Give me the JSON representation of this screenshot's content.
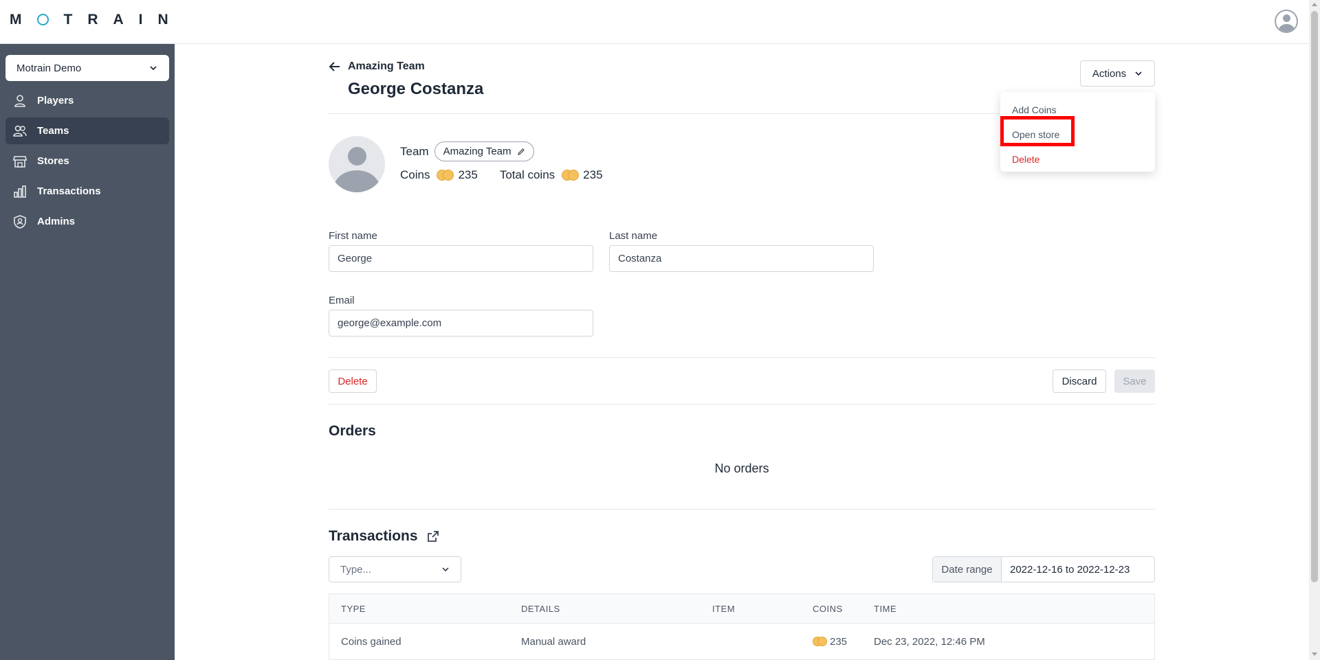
{
  "app": {
    "logo_letters": [
      "M",
      "O",
      "T",
      "R",
      "A",
      "I",
      "N"
    ],
    "accent_color": "#2aa9c9"
  },
  "sidebar": {
    "account": "Motrain Demo",
    "items": [
      {
        "label": "Players",
        "icon": "user-icon"
      },
      {
        "label": "Teams",
        "icon": "users-icon",
        "active": true
      },
      {
        "label": "Stores",
        "icon": "store-icon"
      },
      {
        "label": "Transactions",
        "icon": "chart-bar-icon"
      },
      {
        "label": "Admins",
        "icon": "shield-user-icon"
      }
    ]
  },
  "header": {
    "back_label": "Amazing Team",
    "title": "George Costanza"
  },
  "actions": {
    "button_label": "Actions",
    "menu": [
      {
        "label": "Add Coins"
      },
      {
        "label": "Open store"
      },
      {
        "label": "Delete"
      }
    ]
  },
  "profile": {
    "team_label": "Team",
    "team_name": "Amazing Team",
    "coins_label": "Coins",
    "coins": "235",
    "total_coins_label": "Total coins",
    "total_coins": "235"
  },
  "form": {
    "first_name_label": "First name",
    "first_name": "George",
    "last_name_label": "Last name",
    "last_name": "Costanza",
    "email_label": "Email",
    "email": "george@example.com",
    "delete_label": "Delete",
    "discard_label": "Discard",
    "save_label": "Save"
  },
  "orders": {
    "title": "Orders",
    "empty": "No orders"
  },
  "transactions": {
    "title": "Transactions",
    "type_placeholder": "Type...",
    "date_range_label": "Date range",
    "date_range_value": "2022-12-16 to 2022-12-23",
    "columns": [
      "TYPE",
      "DETAILS",
      "ITEM",
      "COINS",
      "TIME"
    ],
    "rows": [
      {
        "type": "Coins gained",
        "details": "Manual award",
        "item": "",
        "coins": "235",
        "time": "Dec 23, 2022, 12:46 PM"
      }
    ]
  }
}
